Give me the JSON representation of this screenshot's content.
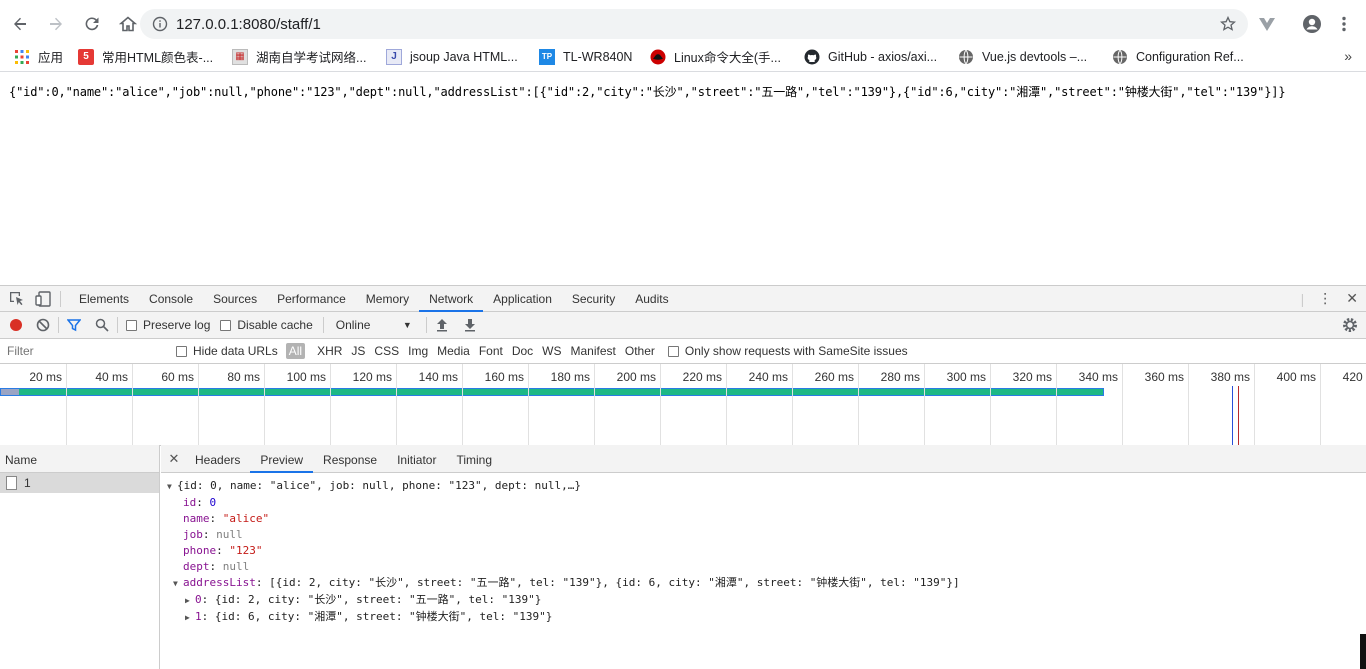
{
  "browser": {
    "url": "127.0.0.1:8080/staff/1",
    "bookmarks": [
      {
        "label": "应用",
        "icon": "apps-grid-icon",
        "color": "#4285f4"
      },
      {
        "label": "常用HTML颜色表-...",
        "icon": "five-logo-icon",
        "color": "#e53935"
      },
      {
        "label": "湖南自学考试网络...",
        "icon": "site-favicon-icon",
        "color": "#888888"
      },
      {
        "label": "jsoup Java HTML...",
        "icon": "j-logo-icon",
        "color": "#5c6bc0"
      },
      {
        "label": "TL-WR840N",
        "icon": "tp-link-icon",
        "color": "#1e88e5"
      },
      {
        "label": "Linux命令大全(手...",
        "icon": "redhat-icon",
        "color": "#cc0000"
      },
      {
        "label": "GitHub - axios/axi...",
        "icon": "github-icon",
        "color": "#24292e"
      },
      {
        "label": "Vue.js devtools –...",
        "icon": "globe-icon",
        "color": "#666666"
      },
      {
        "label": "Configuration Ref...",
        "icon": "globe-icon",
        "color": "#666666"
      }
    ]
  },
  "page": {
    "raw_json": "{\"id\":0,\"name\":\"alice\",\"job\":null,\"phone\":\"123\",\"dept\":null,\"addressList\":[{\"id\":2,\"city\":\"长沙\",\"street\":\"五一路\",\"tel\":\"139\"},{\"id\":6,\"city\":\"湘潭\",\"street\":\"钟楼大街\",\"tel\":\"139\"}]}"
  },
  "devtools": {
    "tabs": [
      "Elements",
      "Console",
      "Sources",
      "Performance",
      "Memory",
      "Network",
      "Application",
      "Security",
      "Audits"
    ],
    "active_tab": "Network",
    "toolbar": {
      "preserve_log": "Preserve log",
      "disable_cache": "Disable cache",
      "throttle": "Online"
    },
    "filter": {
      "placeholder": "Filter",
      "hide_data_urls": "Hide data URLs",
      "types": [
        "All",
        "XHR",
        "JS",
        "CSS",
        "Img",
        "Media",
        "Font",
        "Doc",
        "WS",
        "Manifest",
        "Other"
      ],
      "same_site": "Only show requests with SameSite issues"
    },
    "timeline": {
      "ticks": [
        "20 ms",
        "40 ms",
        "60 ms",
        "80 ms",
        "100 ms",
        "120 ms",
        "140 ms",
        "160 ms",
        "180 ms",
        "200 ms",
        "220 ms",
        "240 ms",
        "260 ms",
        "280 ms",
        "300 ms",
        "320 ms",
        "340 ms",
        "360 ms",
        "380 ms",
        "400 ms",
        "420 ms"
      ],
      "bar_color": "#1db885",
      "bar_border": "#2a7be4"
    },
    "requests": {
      "header": "Name",
      "items": [
        "1"
      ]
    },
    "detail_tabs": [
      "Headers",
      "Preview",
      "Response",
      "Initiator",
      "Timing"
    ],
    "active_detail_tab": "Preview",
    "preview": {
      "summary": "{id: 0, name: \"alice\", job: null, phone: \"123\", dept: null,…}",
      "fields": [
        {
          "key": "id",
          "value": "0",
          "kind": "number"
        },
        {
          "key": "name",
          "value": "\"alice\"",
          "kind": "string"
        },
        {
          "key": "job",
          "value": "null",
          "kind": "null"
        },
        {
          "key": "phone",
          "value": "\"123\"",
          "kind": "string"
        },
        {
          "key": "dept",
          "value": "null",
          "kind": "null"
        }
      ],
      "address_key": "addressList",
      "address_summary": "[{id: 2, city: \"长沙\", street: \"五一路\", tel: \"139\"}, {id: 6, city: \"湘潭\", street: \"钟楼大街\", tel: \"139\"}]",
      "address_items": [
        {
          "index": "0",
          "summary": "{id: 2, city: \"长沙\", street: \"五一路\", tel: \"139\"}"
        },
        {
          "index": "1",
          "summary": "{id: 6, city: \"湘潭\", street: \"钟楼大街\", tel: \"139\"}"
        }
      ]
    }
  }
}
